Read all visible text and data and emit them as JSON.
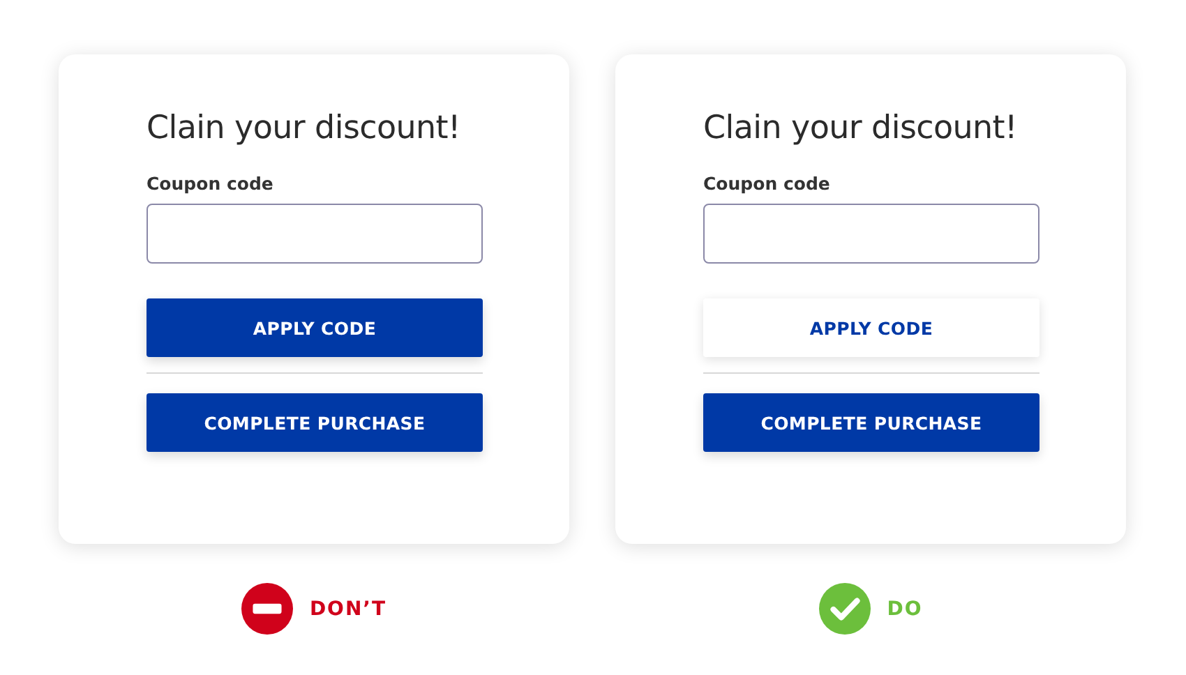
{
  "panels": [
    {
      "title": "Clain your discount!",
      "field_label": "Coupon code",
      "buttons": [
        {
          "label": "APPLY CODE",
          "kind": "primary"
        },
        {
          "label": "COMPLETE PURCHASE",
          "kind": "primary"
        }
      ],
      "verdict": {
        "kind": "dont",
        "label": "DON’T"
      }
    },
    {
      "title": "Clain your discount!",
      "field_label": "Coupon code",
      "buttons": [
        {
          "label": "APPLY CODE",
          "kind": "secondary"
        },
        {
          "label": "COMPLETE PURCHASE",
          "kind": "primary"
        }
      ],
      "verdict": {
        "kind": "do",
        "label": "DO"
      }
    }
  ]
}
